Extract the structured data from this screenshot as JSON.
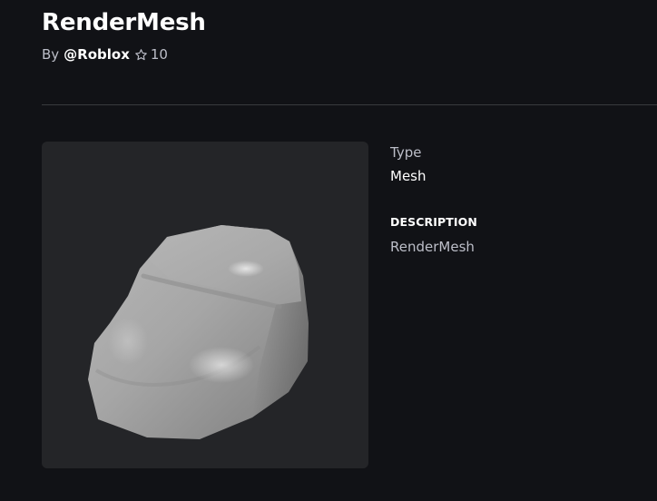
{
  "asset": {
    "title": "RenderMesh",
    "by_prefix": "By",
    "creator": "@Roblox",
    "favorite_icon": "star-outline-icon",
    "favorites": "10",
    "thumbnail_icon": "mesh-3d-preview"
  },
  "details": {
    "type_label": "Type",
    "type_value": "Mesh",
    "description_label": "DESCRIPTION",
    "description_value": "RenderMesh"
  },
  "colors": {
    "background": "#111216",
    "thumbnail_bg": "#242528",
    "divider": "#393b3d",
    "text_primary": "#ffffff",
    "text_secondary": "#bcbec8"
  }
}
